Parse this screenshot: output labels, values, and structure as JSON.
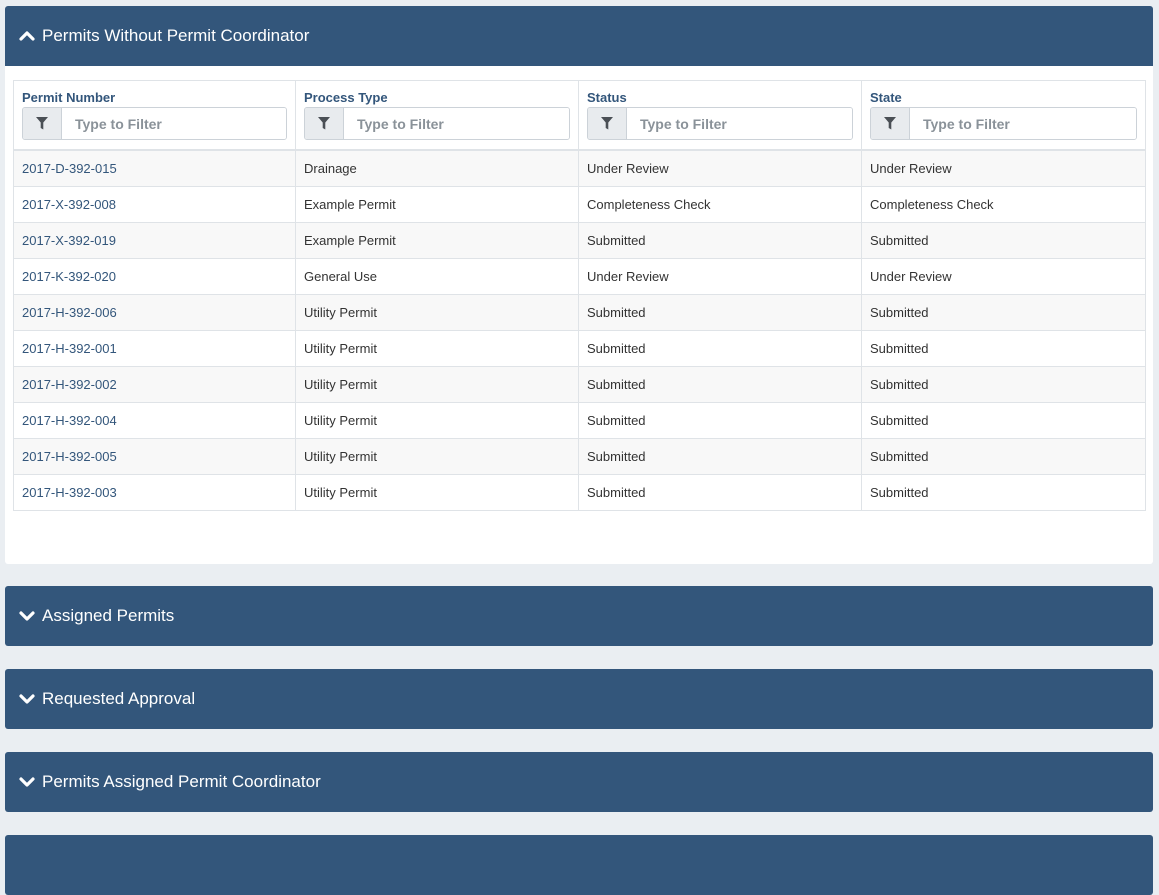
{
  "panels": {
    "main": {
      "title": "Permits Without Permit Coordinator",
      "table": {
        "columns": [
          {
            "label": "Permit Number",
            "placeholder": "Type to Filter"
          },
          {
            "label": "Process Type",
            "placeholder": "Type to Filter"
          },
          {
            "label": "Status",
            "placeholder": "Type to Filter"
          },
          {
            "label": "State",
            "placeholder": "Type to Filter"
          }
        ],
        "rows": [
          [
            "2017-D-392-015",
            "Drainage",
            "Under Review",
            "Under Review"
          ],
          [
            "2017-X-392-008",
            "Example Permit",
            "Completeness Check",
            "Completeness Check"
          ],
          [
            "2017-X-392-019",
            "Example Permit",
            "Submitted",
            "Submitted"
          ],
          [
            "2017-K-392-020",
            "General Use",
            "Under Review",
            "Under Review"
          ],
          [
            "2017-H-392-006",
            "Utility Permit",
            "Submitted",
            "Submitted"
          ],
          [
            "2017-H-392-001",
            "Utility Permit",
            "Submitted",
            "Submitted"
          ],
          [
            "2017-H-392-002",
            "Utility Permit",
            "Submitted",
            "Submitted"
          ],
          [
            "2017-H-392-004",
            "Utility Permit",
            "Submitted",
            "Submitted"
          ],
          [
            "2017-H-392-005",
            "Utility Permit",
            "Submitted",
            "Submitted"
          ],
          [
            "2017-H-392-003",
            "Utility Permit",
            "Submitted",
            "Submitted"
          ]
        ]
      }
    },
    "assigned": {
      "title": "Assigned Permits"
    },
    "requested": {
      "title": "Requested Approval"
    },
    "coordinator": {
      "title": "Permits Assigned Permit Coordinator"
    }
  },
  "colors": {
    "header": "#33567b",
    "link": "#33567b"
  },
  "icons": {
    "expanded": "chevron-up-icon",
    "collapsed": "chevron-down-icon",
    "filter": "filter-icon"
  }
}
